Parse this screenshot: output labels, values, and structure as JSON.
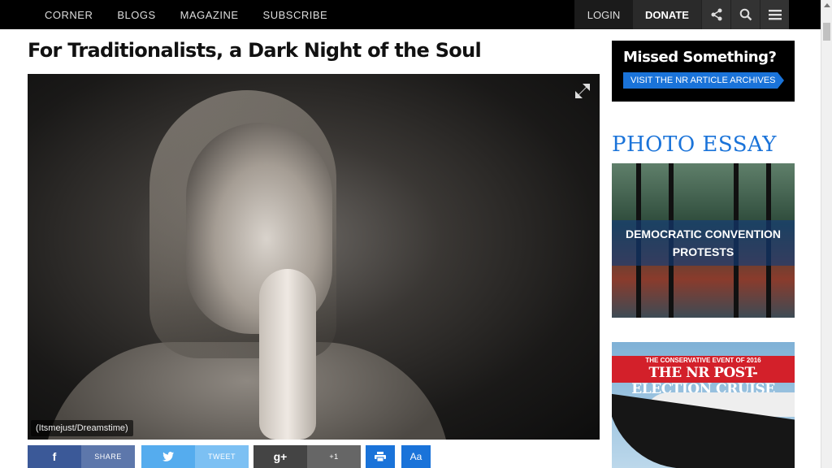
{
  "nav": {
    "left": [
      "CORNER",
      "BLOGS",
      "MAGAZINE",
      "SUBSCRIBE"
    ],
    "login": "LOGIN",
    "donate": "DONATE"
  },
  "article": {
    "title": "For Traditionalists, a Dark Night of the Soul",
    "photo_credit": "(Itsmejust/Dreamstime)"
  },
  "share": {
    "facebook": "SHARE",
    "twitter": "TWEET",
    "gplus": "+1",
    "text_size": "Aa"
  },
  "sidebar": {
    "archive_ad": {
      "title": "Missed Something?",
      "button": "VISIT THE NR ARTICLE ARCHIVES"
    },
    "photo_essay": {
      "heading": "PHOTO ESSAY",
      "caption_line1": "DEMOCRATIC CONVENTION",
      "caption_line2": "PROTESTS"
    },
    "cruise_ad": {
      "kicker": "THE CONSERVATIVE EVENT OF 2016",
      "title": "THE NR POST-ELECTION CRUISE"
    }
  },
  "colors": {
    "accent": "#1a73d9",
    "facebook": "#3b5998",
    "twitter": "#55acee",
    "gplus": "#444444"
  }
}
